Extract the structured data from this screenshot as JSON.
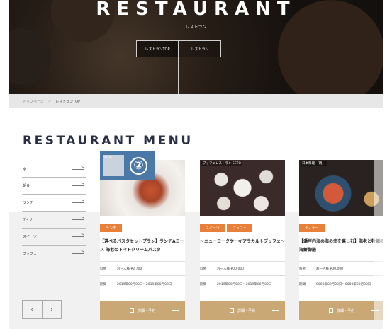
{
  "hero": {
    "title": "RESTAURANT",
    "subtitle": "レストラン",
    "buttons": [
      "レストランTOP",
      "レストラン"
    ]
  },
  "breadcrumb": {
    "home": "トップページ",
    "separator": ">",
    "current": "レストランTOP"
  },
  "menu_title": "RESTAURANT MENU",
  "sidebar": {
    "items": [
      {
        "label": "全て"
      },
      {
        "label": "朝食"
      },
      {
        "label": "ランチ"
      },
      {
        "label": "ディナー"
      },
      {
        "label": "スイーツ"
      },
      {
        "label": "ブッフェ"
      }
    ]
  },
  "pager": {
    "prev": "‹",
    "next": "›"
  },
  "badge": {
    "label": "ALVA",
    "number": "②"
  },
  "cards": [
    {
      "image_tag": "ALVA",
      "categories": [
        "ランチ"
      ],
      "title": "【選べるパスタセットプラン】ランチAコース 海老のトマトクリームパスタ",
      "price_label": "料金",
      "price_value": "お一人様 ¥2,700",
      "period_label": "期間",
      "period_value": "2019年00月00日～2019年00月00日",
      "reserve": "詳細・予約"
    },
    {
      "image_tag": "ブッフェレストラン SETO",
      "categories": [
        "スイーツ",
        "ブッフェ"
      ],
      "title": "～ニューヨークケーキアラカルトブッフェ～",
      "price_label": "料金",
      "price_value": "お一人様 ¥00,000",
      "period_label": "期間",
      "period_value": "2019年00月00日～2019年00月00日",
      "reserve": "詳細・予約"
    },
    {
      "image_tag": "日本料理 「鴎」",
      "categories": [
        "ディナー"
      ],
      "title": "【瀬戸内海の海の幸を楽しむ】海老と牡蠣の 海鮮御膳",
      "price_label": "料金",
      "price_value": "お一人様 ¥00,000",
      "period_label": "期間",
      "period_value": "0000年00月00日～0000年00月00日",
      "reserve": "詳細・予約"
    }
  ],
  "colors": {
    "category": "#e8803a",
    "reserve": "#c9a876",
    "title": "#2a2f44",
    "badge": "#4a79a8"
  }
}
